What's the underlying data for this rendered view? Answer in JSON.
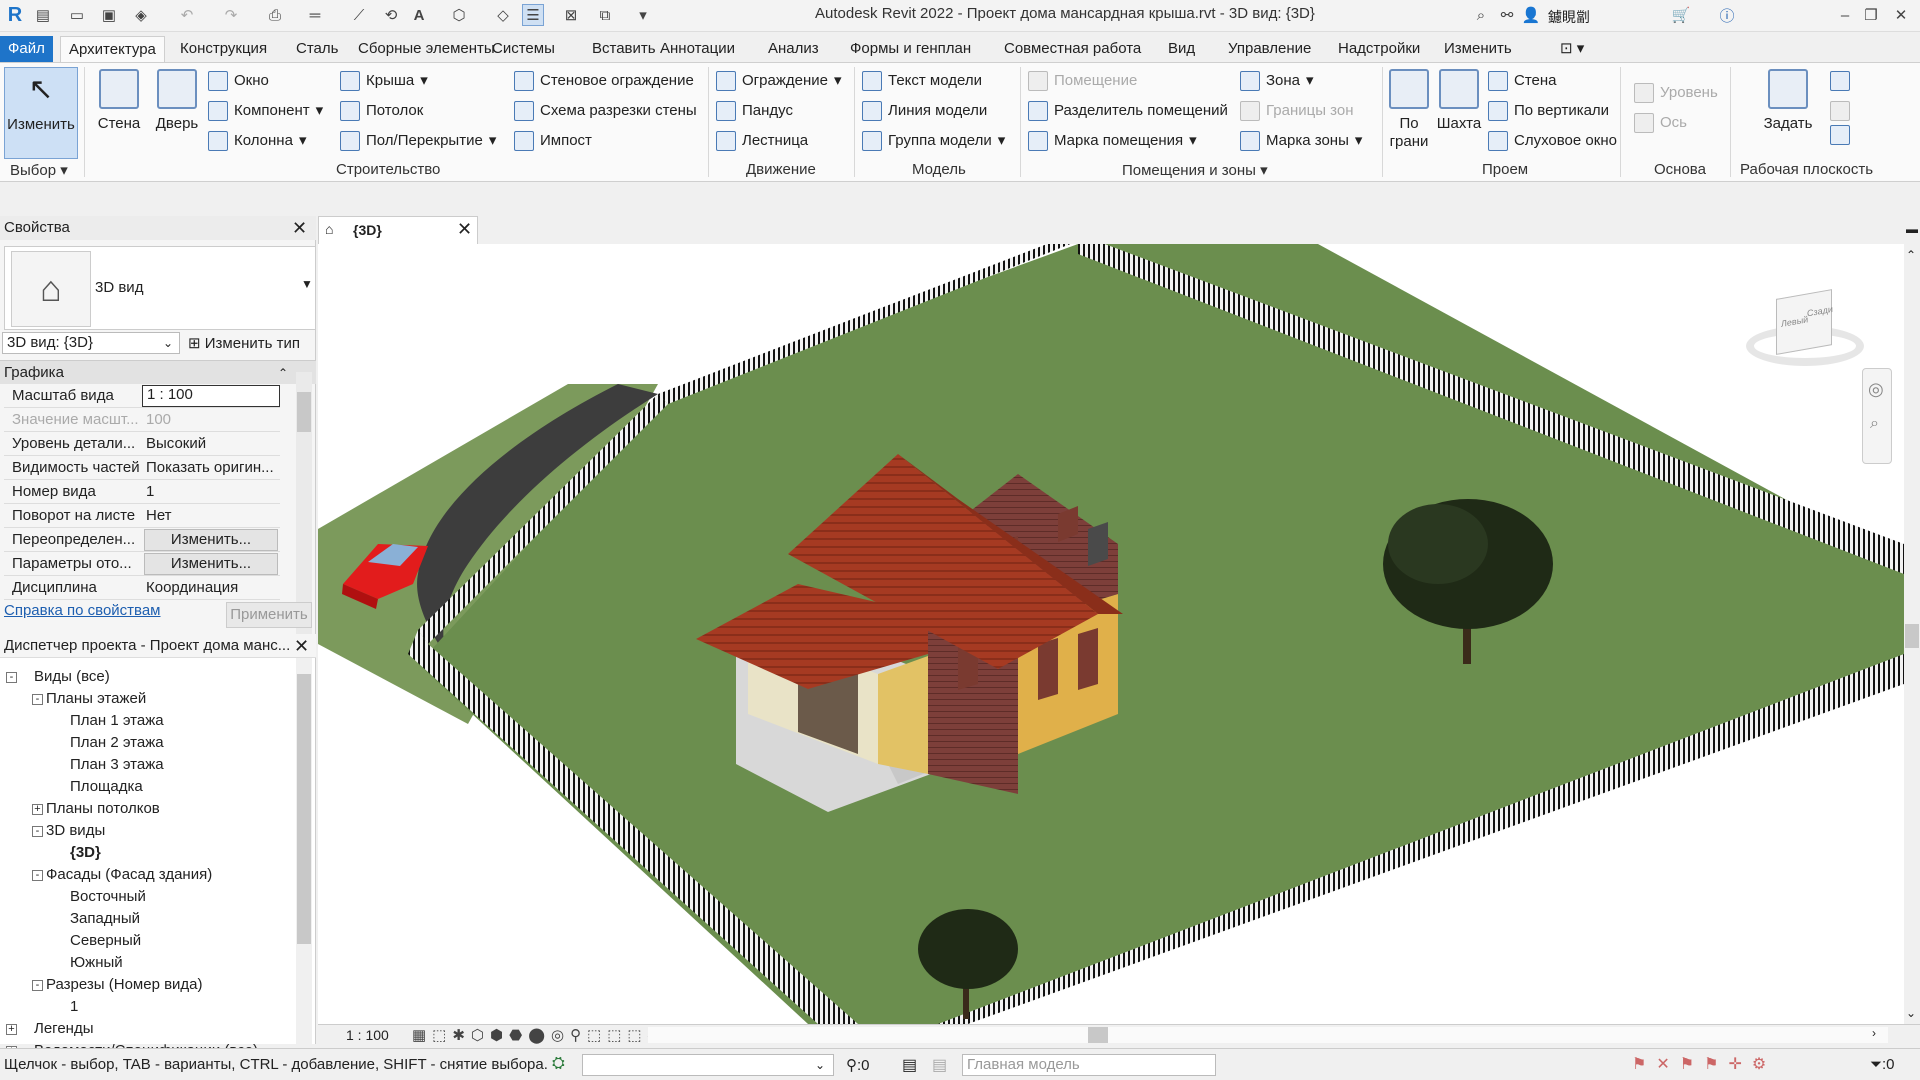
{
  "app": {
    "title": "Autodesk Revit 2022 - Проект дома мансардная крыша.rvt - 3D вид: {3D}",
    "user": "鑢睍劏"
  },
  "tabs": [
    "Файл",
    "Архитектура",
    "Конструкция",
    "Сталь",
    "Сборные элементы",
    "Системы",
    "Вставить",
    "Аннотации",
    "Анализ",
    "Формы и генплан",
    "Совместная работа",
    "Вид",
    "Управление",
    "Надстройки",
    "Изменить"
  ],
  "ribbon": {
    "select": {
      "modify": "Изменить",
      "panel": "Выбор"
    },
    "build": {
      "wall": "Стена",
      "door": "Дверь",
      "window": "Окно",
      "component": "Компонент",
      "column": "Колонна",
      "roof": "Крыша",
      "ceiling": "Потолок",
      "floor": "Пол/Перекрытие",
      "curtain_system": "Стеновое ограждение",
      "curtain_grid": "Схема разрезки стены",
      "mullion": "Импост",
      "panel": "Строительство"
    },
    "circulation": {
      "railing": "Ограждение",
      "ramp": "Пандус",
      "stair": "Лестница",
      "panel": "Движение"
    },
    "model": {
      "text": "Текст модели",
      "line": "Линия модели",
      "group": "Группа модели",
      "panel": "Модель"
    },
    "rooms": {
      "room": "Помещение",
      "separator": "Разделитель помещений",
      "tag": "Марка помещения",
      "area": "Зона",
      "area_boundary": "Границы зон",
      "area_tag": "Марка зоны",
      "panel": "Помещения и зоны"
    },
    "opening": {
      "by_face": "По грани",
      "shaft": "Шахта",
      "wall": "Стена",
      "vertical": "По вертикали",
      "dormer": "Слуховое окно",
      "panel": "Проем"
    },
    "datum": {
      "level": "Уровень",
      "grid": "Ось",
      "panel": "Основа"
    },
    "workplane": {
      "set": "Задать",
      "panel": "Рабочая плоскость"
    }
  },
  "properties": {
    "header": "Свойства",
    "type_name": "3D вид",
    "selector": "3D вид: {3D}",
    "edit_type": "Изменить тип",
    "group": "Графика",
    "rows": [
      {
        "k": "Масштаб вида",
        "v": "1 : 100"
      },
      {
        "k": "Значение масшт...",
        "v": "100"
      },
      {
        "k": "Уровень детали...",
        "v": "Высокий"
      },
      {
        "k": "Видимость частей",
        "v": "Показать оригин..."
      },
      {
        "k": "Номер вида",
        "v": "1"
      },
      {
        "k": "Поворот на листе",
        "v": "Нет"
      },
      {
        "k": "Переопределен...",
        "v": "Изменить..."
      },
      {
        "k": "Параметры ото...",
        "v": "Изменить..."
      },
      {
        "k": "Дисциплина",
        "v": "Координация"
      }
    ],
    "help": "Справка по свойствам",
    "apply": "Применить"
  },
  "browser": {
    "header": "Диспетчер проекта - Проект дома манс...",
    "nodes": [
      {
        "label": "Виды (все)",
        "level": 0
      },
      {
        "label": "Планы этажей",
        "level": 1
      },
      {
        "label": "План 1 этажа",
        "level": 2
      },
      {
        "label": "План 2 этажа",
        "level": 2
      },
      {
        "label": "План 3 этажа",
        "level": 2
      },
      {
        "label": "Площадка",
        "level": 2
      },
      {
        "label": "Планы потолков",
        "level": 1
      },
      {
        "label": "3D виды",
        "level": 1
      },
      {
        "label": "{3D}",
        "level": 2
      },
      {
        "label": "Фасады (Фасад здания)",
        "level": 1
      },
      {
        "label": "Восточный",
        "level": 2
      },
      {
        "label": "Западный",
        "level": 2
      },
      {
        "label": "Северный",
        "level": 2
      },
      {
        "label": "Южный",
        "level": 2
      },
      {
        "label": "Разрезы (Номер вида)",
        "level": 1
      },
      {
        "label": "1",
        "level": 2
      },
      {
        "label": "Легенды",
        "level": 0
      },
      {
        "label": "Ведомости/Спецификации (все)",
        "level": 0
      }
    ]
  },
  "view": {
    "tab": "{3D}",
    "scale": "1 : 100",
    "viewcube": {
      "left": "Левый",
      "back": "Сзади"
    }
  },
  "status": {
    "hint": "Щелчок - выбор, TAB - варианты, CTRL - добавление, SHIFT - снятие выбора.",
    "count": ":0",
    "model": "Главная модель",
    "filter_count": ":0"
  },
  "colors": {
    "accent": "#1e74c9",
    "grass": "#6b8e4e",
    "roof": "#a33a24",
    "road": "#3d3d3d"
  }
}
